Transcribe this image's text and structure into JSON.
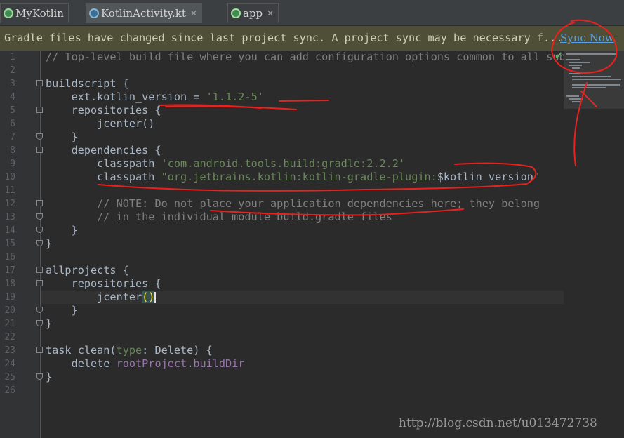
{
  "tabs": [
    {
      "label": "MyKotlin",
      "icon": "kotlin-module-icon"
    },
    {
      "label": "KotlinActivity.kt",
      "icon": "kotlin-file-icon"
    },
    {
      "label": "app",
      "icon": "gradle-file-icon"
    }
  ],
  "notification": {
    "text": "Gradle files have changed since last project sync. A project sync may be necessary f...",
    "action": "Sync Now"
  },
  "line_numbers": [
    "1",
    "2",
    "3",
    "4",
    "5",
    "6",
    "7",
    "8",
    "9",
    "10",
    "11",
    "12",
    "13",
    "14",
    "15",
    "16",
    "17",
    "18",
    "19",
    "20",
    "21",
    "22",
    "23",
    "24",
    "25",
    "26"
  ],
  "code": {
    "l1": "// Top-level build file where you can add configuration options common to all sub",
    "l3": "buildscript {",
    "l4a": "    ext.kotlin_version = ",
    "l4b": "'1.1.2-5'",
    "l5": "    repositories {",
    "l6": "        jcenter()",
    "l7": "    }",
    "l8": "    dependencies {",
    "l9a": "        classpath ",
    "l9b": "'com.android.tools.build:gradle:2.2.2'",
    "l10a": "        classpath ",
    "l10b": "\"org.jetbrains.kotlin:kotlin-gradle-plugin:",
    "l10c": "$kotlin_version",
    "l10d": "\"",
    "l12": "        // NOTE: Do not place your application dependencies here; they belong",
    "l13": "        // in the individual module build.gradle files",
    "l14": "    }",
    "l15": "}",
    "l17": "allprojects {",
    "l18": "    repositories {",
    "l19a": "        jcenter",
    "l19b": "()",
    "l20": "    }",
    "l21": "}",
    "l23a": "task clean(",
    "l23b": "type",
    "l23c": ": Delete) {",
    "l24a": "    delete ",
    "l24b": "rootProject",
    "l24c": ".",
    "l24d": "buildDir",
    "l25": "}"
  },
  "watermark": "http://blog.csdn.net/u013472738"
}
